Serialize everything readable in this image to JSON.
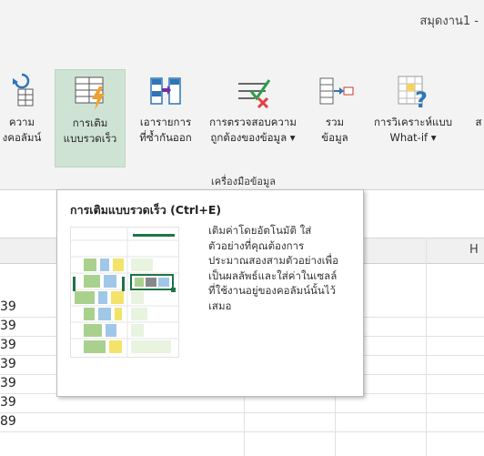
{
  "window": {
    "title": "สมุดงาน1 -"
  },
  "ribbon": {
    "buttons": [
      {
        "label_line1": "ความ",
        "label_line2": "งคอลัมน์"
      },
      {
        "label_line1": "การเติม",
        "label_line2": "แบบรวดเร็ว"
      },
      {
        "label_line1": "เอารายการ",
        "label_line2": "ที่ซ้ำกันออก"
      },
      {
        "label_line1": "การตรวจสอบความ",
        "label_line2": "ถูกต้องของข้อมูล ▾"
      },
      {
        "label_line1": "รวม",
        "label_line2": "ข้อมูล"
      },
      {
        "label_line1": "การวิเคราะห์แบบ",
        "label_line2": "What-if ▾"
      },
      {
        "label_line1": "",
        "label_line2": "ส"
      }
    ],
    "group_label": "เครื่องมือข้อมูล"
  },
  "grid": {
    "column_header_visible": "H",
    "row_values": [
      "39",
      "39",
      "39",
      "39",
      "39",
      "39",
      "89"
    ]
  },
  "tooltip": {
    "title": "การเติมแบบรวดเร็ว (Ctrl+E)",
    "description": "เติมค่าโดยอัตโนมัติ ใส่\nตัวอย่างที่คุณต้องการ\nประมาณสองสามตัวอย่างเพื่อ\nเป็นผลลัพธ์และใส่ค่าในเซลล์\nที่ใช้งานอยู่ของคอลัมน์นั้นไว้\nเสมอ"
  },
  "colors": {
    "accent_green": "#217346",
    "active_bg": "#cfe3d5",
    "illus_blue": "#9fc8e8",
    "illus_green": "#a9d18e",
    "illus_yellow": "#f4e36a"
  }
}
